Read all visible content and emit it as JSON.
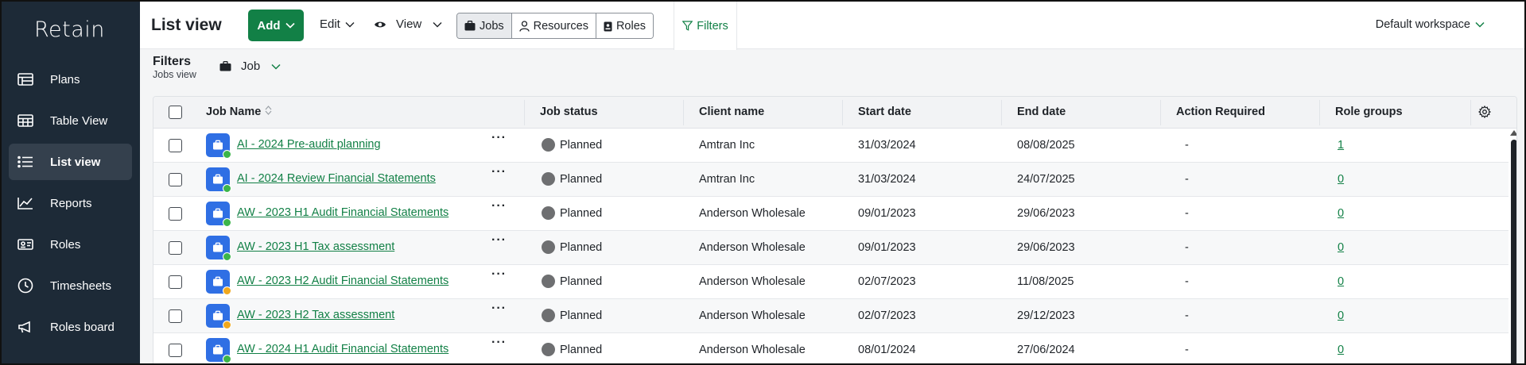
{
  "app": {
    "logo_text": "Retain"
  },
  "sidebar": {
    "items": [
      {
        "label": "Plans",
        "icon": "plans-icon"
      },
      {
        "label": "Table View",
        "icon": "table-icon"
      },
      {
        "label": "List view",
        "icon": "list-icon",
        "active": true
      },
      {
        "label": "Reports",
        "icon": "chart-icon"
      },
      {
        "label": "Roles",
        "icon": "id-card-icon"
      },
      {
        "label": "Timesheets",
        "icon": "clock-icon"
      },
      {
        "label": "Roles board",
        "icon": "megaphone-icon"
      }
    ]
  },
  "header": {
    "title": "List view",
    "add_label": "Add",
    "edit_label": "Edit",
    "view_label": "View",
    "segments": [
      {
        "label": "Jobs",
        "active": true
      },
      {
        "label": "Resources"
      },
      {
        "label": "Roles"
      }
    ],
    "filters_label": "Filters",
    "workspace_label": "Default workspace"
  },
  "filterbar": {
    "title": "Filters",
    "subtitle": "Jobs view",
    "job_label": "Job"
  },
  "table": {
    "columns": [
      "Job Name",
      "Job status",
      "Client name",
      "Start date",
      "End date",
      "Action Required",
      "Role groups"
    ],
    "more_glyph": "···",
    "rows": [
      {
        "name": "AI - 2024 Pre-audit planning",
        "status": "Planned",
        "client": "Amtran Inc",
        "start": "31/03/2024",
        "end": "08/08/2025",
        "action": "-",
        "roles": "1",
        "dot_color": "#3cb54a"
      },
      {
        "name": "AI - 2024 Review Financial Statements",
        "status": "Planned",
        "client": "Amtran Inc",
        "start": "31/03/2024",
        "end": "24/07/2025",
        "action": "-",
        "roles": "0",
        "dot_color": "#3cb54a"
      },
      {
        "name": "AW - 2023 H1 Audit Financial Statements",
        "status": "Planned",
        "client": "Anderson Wholesale",
        "start": "09/01/2023",
        "end": "29/06/2023",
        "action": "-",
        "roles": "0",
        "dot_color": "#3cb54a"
      },
      {
        "name": "AW - 2023 H1 Tax assessment",
        "status": "Planned",
        "client": "Anderson Wholesale",
        "start": "09/01/2023",
        "end": "29/06/2023",
        "action": "-",
        "roles": "0",
        "dot_color": "#3cb54a"
      },
      {
        "name": "AW - 2023 H2 Audit Financial Statements",
        "status": "Planned",
        "client": "Anderson Wholesale",
        "start": "02/07/2023",
        "end": "11/08/2025",
        "action": "-",
        "roles": "0",
        "dot_color": "#f0a81e"
      },
      {
        "name": "AW - 2023 H2 Tax assessment",
        "status": "Planned",
        "client": "Anderson Wholesale",
        "start": "02/07/2023",
        "end": "29/12/2023",
        "action": "-",
        "roles": "0",
        "dot_color": "#f0a81e"
      },
      {
        "name": "AW - 2024 H1 Audit Financial Statements",
        "status": "Planned",
        "client": "Anderson Wholesale",
        "start": "08/01/2024",
        "end": "27/06/2024",
        "action": "-",
        "roles": "0",
        "dot_color": "#3cb54a"
      }
    ]
  },
  "colors": {
    "sidebar_bg": "#1d2a37",
    "accent_green": "#128046",
    "job_icon_blue": "#2f6fe4",
    "status_grey": "#6e6f71"
  }
}
